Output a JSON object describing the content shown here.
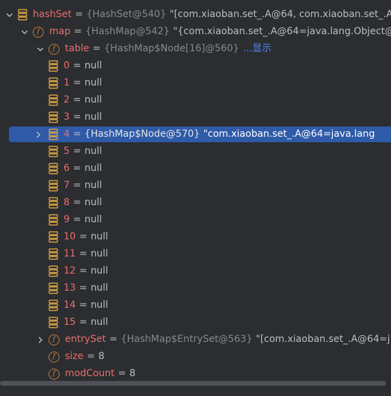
{
  "tree": {
    "hashset": {
      "name": "hashSet",
      "type": "{HashSet@540}",
      "value": "\"[com.xiaoban.set_.A@64, com.xiaoban.set_.A"
    },
    "map": {
      "name": "map",
      "type": "{HashMap@542}",
      "value": "\"{com.xiaoban.set_.A@64=java.lang.Object@"
    },
    "table": {
      "name": "table",
      "type": "{HashMap$Node[16]@560}",
      "show_link": "...显示"
    },
    "elements": [
      {
        "index": "0",
        "value": "null"
      },
      {
        "index": "1",
        "value": "null"
      },
      {
        "index": "2",
        "value": "null"
      },
      {
        "index": "3",
        "value": "null"
      },
      {
        "index": "4",
        "type": "{HashMap$Node@570}",
        "value": "\"com.xiaoban.set_.A@64=java.lang"
      },
      {
        "index": "5",
        "value": "null"
      },
      {
        "index": "6",
        "value": "null"
      },
      {
        "index": "7",
        "value": "null"
      },
      {
        "index": "8",
        "value": "null"
      },
      {
        "index": "9",
        "value": "null"
      },
      {
        "index": "10",
        "value": "null"
      },
      {
        "index": "11",
        "value": "null"
      },
      {
        "index": "12",
        "value": "null"
      },
      {
        "index": "13",
        "value": "null"
      },
      {
        "index": "14",
        "value": "null"
      },
      {
        "index": "15",
        "value": "null"
      }
    ],
    "entryset": {
      "name": "entrySet",
      "type": "{HashMap$EntrySet@563}",
      "value": "\"[com.xiaoban.set_.A@64=j"
    },
    "size": {
      "name": "size",
      "value": "8"
    },
    "modcount": {
      "name": "modCount",
      "value": "8"
    },
    "field_badge": "f",
    "equals": "="
  },
  "colors": {
    "background": "#2b2d30",
    "selection": "#2e5aa8",
    "field_name": "#c77dbb",
    "field_icon": "#c77e3b",
    "type_gray": "#868a91",
    "link_blue": "#548af7"
  }
}
